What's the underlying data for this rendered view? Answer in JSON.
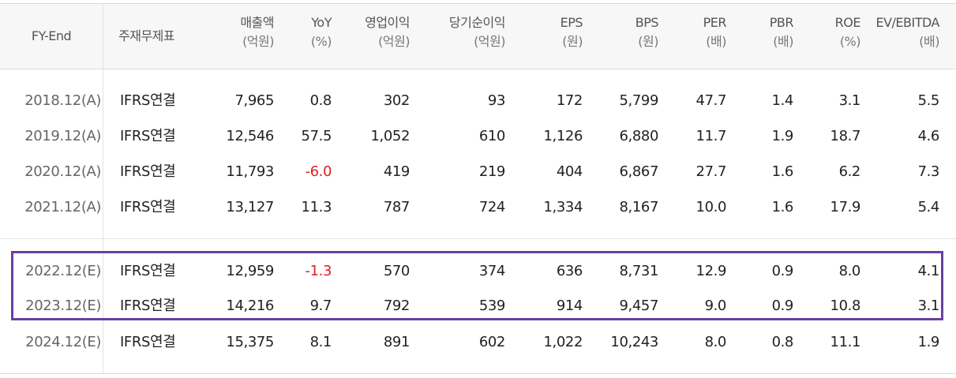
{
  "table": {
    "headers": {
      "fy_end": "FY-End",
      "consolidation": "주재무제표",
      "columns": [
        {
          "line1": "매출액",
          "line2": "(억원)"
        },
        {
          "line1": "YoY",
          "line2": "(%)"
        },
        {
          "line1": "영업이익",
          "line2": "(억원)"
        },
        {
          "line1": "당기순이익",
          "line2": "(억원)"
        },
        {
          "line1": "EPS",
          "line2": "(원)"
        },
        {
          "line1": "BPS",
          "line2": "(원)"
        },
        {
          "line1": "PER",
          "line2": "(배)"
        },
        {
          "line1": "PBR",
          "line2": "(배)"
        },
        {
          "line1": "ROE",
          "line2": "(%)"
        },
        {
          "line1": "EV/EBITDA",
          "line2": "(배)"
        }
      ]
    },
    "rows": [
      {
        "fy": "2018.12(A)",
        "cons": "IFRS연결",
        "v": [
          "7,965",
          "0.8",
          "302",
          "93",
          "172",
          "5,799",
          "47.7",
          "1.4",
          "3.1",
          "5.5"
        ]
      },
      {
        "fy": "2019.12(A)",
        "cons": "IFRS연결",
        "v": [
          "12,546",
          "57.5",
          "1,052",
          "610",
          "1,126",
          "6,880",
          "11.7",
          "1.9",
          "18.7",
          "4.6"
        ]
      },
      {
        "fy": "2020.12(A)",
        "cons": "IFRS연결",
        "v": [
          "11,793",
          "-6.0",
          "419",
          "219",
          "404",
          "6,867",
          "27.7",
          "1.6",
          "6.2",
          "7.3"
        ]
      },
      {
        "fy": "2021.12(A)",
        "cons": "IFRS연결",
        "v": [
          "13,127",
          "11.3",
          "787",
          "724",
          "1,334",
          "8,167",
          "10.0",
          "1.6",
          "17.9",
          "5.4"
        ]
      },
      {
        "fy": "2022.12(E)",
        "cons": "IFRS연결",
        "v": [
          "12,959",
          "-1.3",
          "570",
          "374",
          "636",
          "8,731",
          "12.9",
          "0.9",
          "8.0",
          "4.1"
        ]
      },
      {
        "fy": "2023.12(E)",
        "cons": "IFRS연결",
        "v": [
          "14,216",
          "9.7",
          "792",
          "539",
          "914",
          "9,457",
          "9.0",
          "0.9",
          "10.8",
          "3.1"
        ]
      },
      {
        "fy": "2024.12(E)",
        "cons": "IFRS연결",
        "v": [
          "15,375",
          "8.1",
          "891",
          "602",
          "1,022",
          "10,243",
          "8.0",
          "0.8",
          "11.1",
          "1.9"
        ]
      }
    ],
    "highlighted_rows": [
      "2022.12(E)",
      "2023.12(E)"
    ],
    "colors": {
      "negative": "#e02020",
      "highlight_border": "#6b3fa0",
      "header_bg": "#f7f7f7"
    }
  }
}
